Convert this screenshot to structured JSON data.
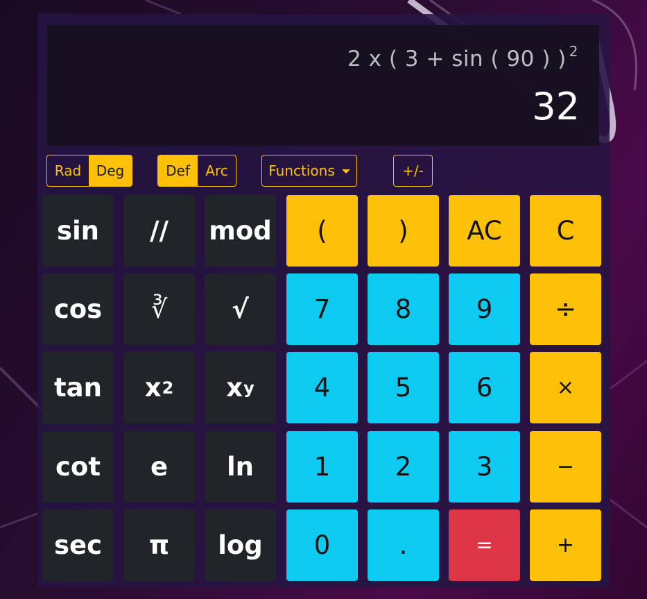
{
  "display": {
    "expression": "2 x ( 3 + sin ( 90 ) )",
    "expression_power": "2",
    "result": "32"
  },
  "angle_mode": {
    "options": [
      "Rad",
      "Deg"
    ],
    "selected": "Deg"
  },
  "function_mode": {
    "options": [
      "Def",
      "Arc"
    ],
    "selected": "Def"
  },
  "functions_dropdown": {
    "label": "Functions"
  },
  "sign_toggle": {
    "label": "+/-"
  },
  "keys": {
    "sin": "sin",
    "floor_div": "//",
    "mod": "mod",
    "lparen": "(",
    "rparen": ")",
    "ac": "AC",
    "c": "C",
    "cos": "cos",
    "cbrt": "∛",
    "sqrt": "√",
    "n7": "7",
    "n8": "8",
    "n9": "9",
    "divide": "÷",
    "tan": "tan",
    "square_base": "x",
    "square_exp": "2",
    "power_base": "x",
    "power_exp": "y",
    "n4": "4",
    "n5": "5",
    "n6": "6",
    "multiply": "×",
    "cot": "cot",
    "e": "e",
    "ln": "ln",
    "n1": "1",
    "n2": "2",
    "n3": "3",
    "minus": "−",
    "sec": "sec",
    "pi": "π",
    "log": "log",
    "n0": "0",
    "dot": ".",
    "equals": "=",
    "plus": "+"
  },
  "colors": {
    "accent": "#ffc107",
    "digit": "#0dcaf0",
    "equals": "#dc3545",
    "function_key": "#212529"
  }
}
